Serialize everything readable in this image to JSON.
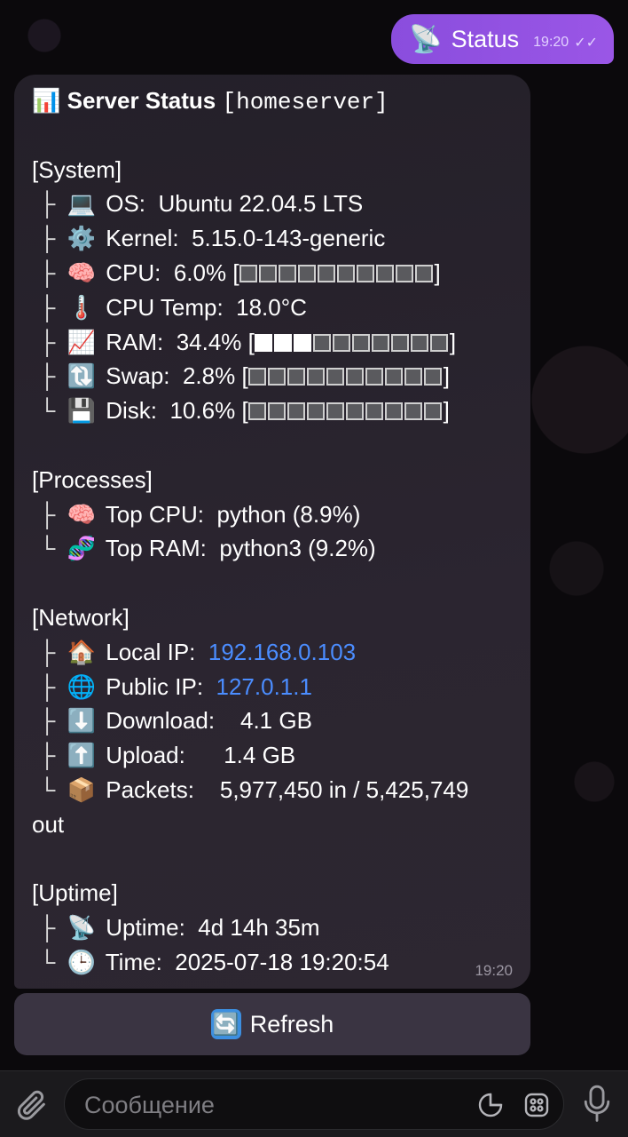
{
  "outgoing": {
    "icon": "📡",
    "text": "Status",
    "time": "19:20",
    "ticks": "✓✓"
  },
  "message": {
    "title_icon": "📊",
    "title": "Server Status",
    "host": "[homeserver]",
    "system": {
      "header": "[System]",
      "os": {
        "tree": "├",
        "icon": "💻",
        "label": "OS:",
        "value": "Ubuntu 22.04.5 LTS"
      },
      "kernel": {
        "tree": "├",
        "icon": "⚙️",
        "label": "Kernel:",
        "value": "5.15.0-143-generic"
      },
      "cpu": {
        "tree": "├",
        "icon": "🧠",
        "label": "CPU:",
        "value": "6.0%",
        "bar_filled": 0,
        "bar_total": 10
      },
      "cpu_temp": {
        "tree": "├",
        "icon": "🌡️",
        "label": "CPU Temp:",
        "value": "18.0°C"
      },
      "ram": {
        "tree": "├",
        "icon": "📈",
        "label": "RAM:",
        "value": "34.4%",
        "bar_filled": 3,
        "bar_total": 10
      },
      "swap": {
        "tree": "├",
        "icon": "🔃",
        "label": "Swap:",
        "value": "2.8%",
        "bar_filled": 0,
        "bar_total": 10
      },
      "disk": {
        "tree": "└",
        "icon": "💾",
        "label": "Disk:",
        "value": "10.6%",
        "bar_filled": 0,
        "bar_total": 10
      }
    },
    "processes": {
      "header": "[Processes]",
      "top_cpu": {
        "tree": "├",
        "icon": "🧠",
        "label": "Top CPU:",
        "value": "python (8.9%)"
      },
      "top_ram": {
        "tree": "└",
        "icon": "🧬",
        "label": "Top RAM:",
        "value": "python3 (9.2%)"
      }
    },
    "network": {
      "header": "[Network]",
      "local_ip": {
        "tree": "├",
        "icon": "🏠",
        "label": "Local IP:",
        "value": "192.168.0.103"
      },
      "public_ip": {
        "tree": "├",
        "icon": "🌐",
        "label": "Public IP:",
        "value": "127.0.1.1"
      },
      "download": {
        "tree": "├",
        "icon": "⬇️",
        "label": "Download:",
        "value": "4.1 GB"
      },
      "upload": {
        "tree": "├",
        "icon": "⬆️",
        "label": "Upload:",
        "value": "1.4 GB"
      },
      "packets": {
        "tree": "└",
        "icon": "📦",
        "label": "Packets:",
        "value": "5,977,450 in / 5,425,749",
        "value_cont": "out"
      }
    },
    "uptime": {
      "header": "[Uptime]",
      "uptime": {
        "tree": "├",
        "icon": "📡",
        "label": "Uptime:",
        "value": "4d 14h 35m"
      },
      "time": {
        "tree": "└",
        "icon": "🕒",
        "label": "Time:",
        "value": "2025-07-18 19:20:54"
      }
    },
    "time": "19:20"
  },
  "refresh_button": {
    "icon": "🔄",
    "label": "Refresh"
  },
  "input": {
    "placeholder": "Сообщение"
  },
  "colors": {
    "accent": "#9a56e6",
    "link": "#4b8dff",
    "bubble": "#2b2530"
  }
}
